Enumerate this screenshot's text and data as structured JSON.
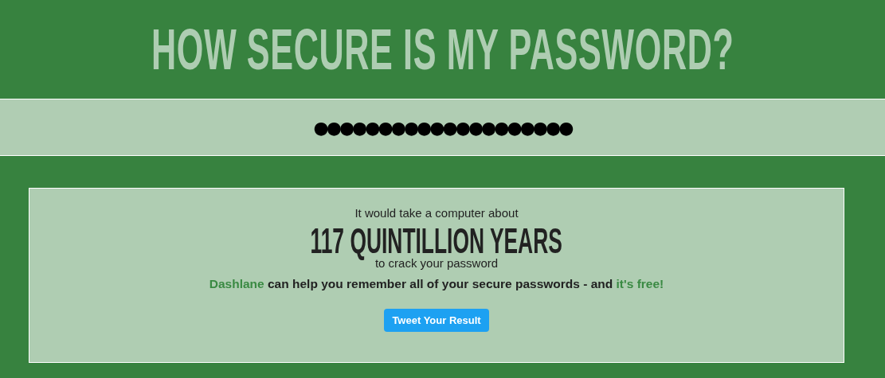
{
  "title": "HOW SECURE IS MY PASSWORD?",
  "password_field": {
    "value": "●●●●●●●●●●●●●●●●●●●●"
  },
  "result": {
    "lead": "It would take a computer about",
    "time": "117 QUINTILLION YEARS",
    "tail": "to crack your password",
    "promo": {
      "link": "Dashlane",
      "text": "can help you remember all of your secure passwords - and",
      "end_link": "it's free!"
    },
    "button": "Tweet Your Result"
  }
}
